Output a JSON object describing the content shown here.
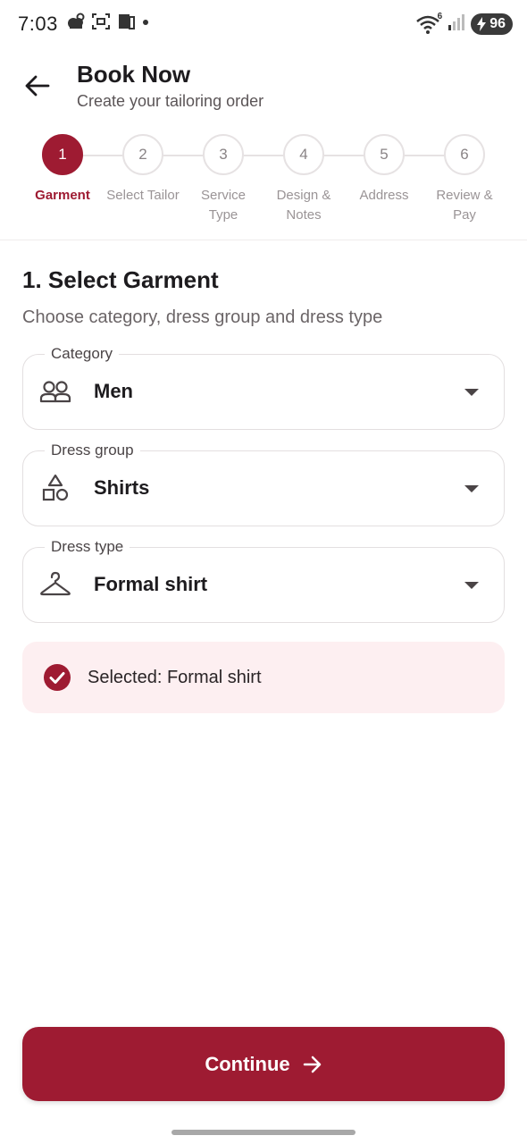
{
  "status_bar": {
    "time": "7:03",
    "battery": "96",
    "wifi_badge": "6"
  },
  "header": {
    "title": "Book Now",
    "subtitle": "Create your tailoring order"
  },
  "stepper": {
    "steps": [
      {
        "number": "1",
        "label": "Garment",
        "active": true
      },
      {
        "number": "2",
        "label": "Select Tailor",
        "active": false
      },
      {
        "number": "3",
        "label": "Service Type",
        "active": false
      },
      {
        "number": "4",
        "label": "Design & Notes",
        "active": false
      },
      {
        "number": "5",
        "label": "Address",
        "active": false
      },
      {
        "number": "6",
        "label": "Review & Pay",
        "active": false
      }
    ]
  },
  "section": {
    "title": "1. Select Garment",
    "subtitle": "Choose category, dress group and dress type"
  },
  "fields": {
    "category": {
      "label": "Category",
      "value": "Men",
      "icon": "people-icon"
    },
    "dress_group": {
      "label": "Dress group",
      "value": "Shirts",
      "icon": "shapes-icon"
    },
    "dress_type": {
      "label": "Dress type",
      "value": "Formal shirt",
      "icon": "hanger-icon"
    }
  },
  "selection": {
    "text": "Selected: Formal shirt",
    "icon": "check-circle-icon"
  },
  "actions": {
    "continue_label": "Continue",
    "continue_icon": "arrow-right-icon"
  },
  "colors": {
    "primary": "#9e1b32",
    "banner_bg": "#fdeff1",
    "border": "#e3dfe0"
  }
}
